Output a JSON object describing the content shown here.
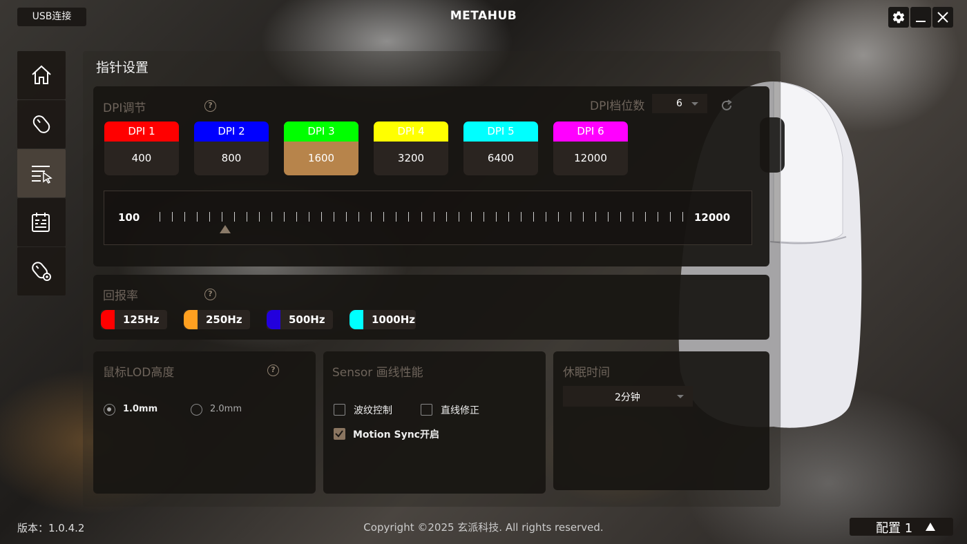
{
  "titlebar": {
    "connection": "USB连接",
    "app_title": "METAHUB"
  },
  "page": {
    "title": "指针设置"
  },
  "dpi": {
    "label": "DPI调节",
    "levels_label": "DPI档位数",
    "levels_value": "6",
    "cards": [
      {
        "name": "DPI 1",
        "value": "400",
        "color": "#ff0000"
      },
      {
        "name": "DPI 2",
        "value": "800",
        "color": "#0000ff"
      },
      {
        "name": "DPI 3",
        "value": "1600",
        "color": "#00ff00"
      },
      {
        "name": "DPI 4",
        "value": "3200",
        "color": "#ffff00"
      },
      {
        "name": "DPI 5",
        "value": "6400",
        "color": "#00ffff"
      },
      {
        "name": "DPI 6",
        "value": "12000",
        "color": "#ff00ff"
      }
    ],
    "active_index": 2,
    "slider": {
      "min": "100",
      "max": "12000",
      "current": 1600
    }
  },
  "polling": {
    "label": "回报率",
    "options": [
      {
        "label": "125Hz",
        "color": "#ff0000"
      },
      {
        "label": "250Hz",
        "color": "#ffa020"
      },
      {
        "label": "500Hz",
        "color": "#2200dd"
      },
      {
        "label": "1000Hz",
        "color": "#00ffff"
      }
    ]
  },
  "lod": {
    "label": "鼠标LOD高度",
    "options": [
      "1.0mm",
      "2.0mm"
    ],
    "selected": "1.0mm"
  },
  "sensor": {
    "label": "Sensor 画线性能",
    "options": [
      {
        "label": "波纹控制",
        "checked": false
      },
      {
        "label": "直线修正",
        "checked": false
      },
      {
        "label": "Motion Sync开启",
        "checked": true
      }
    ]
  },
  "sleep": {
    "label": "休眠时间",
    "value": "2分钟"
  },
  "footer": {
    "version": "版本：1.0.4.2",
    "copyright": "Copyright  ©2025 玄派科技. All rights reserved.",
    "profile": "配置 1"
  },
  "icons": {
    "sidebar": [
      "home-icon",
      "mouse-icon",
      "pointer-settings-icon",
      "macro-icon",
      "mouse-settings-icon"
    ],
    "window": [
      "gear-icon",
      "minimize-icon",
      "close-icon"
    ]
  },
  "colors": {
    "accent": "#b7844b",
    "panel": "#181512"
  }
}
